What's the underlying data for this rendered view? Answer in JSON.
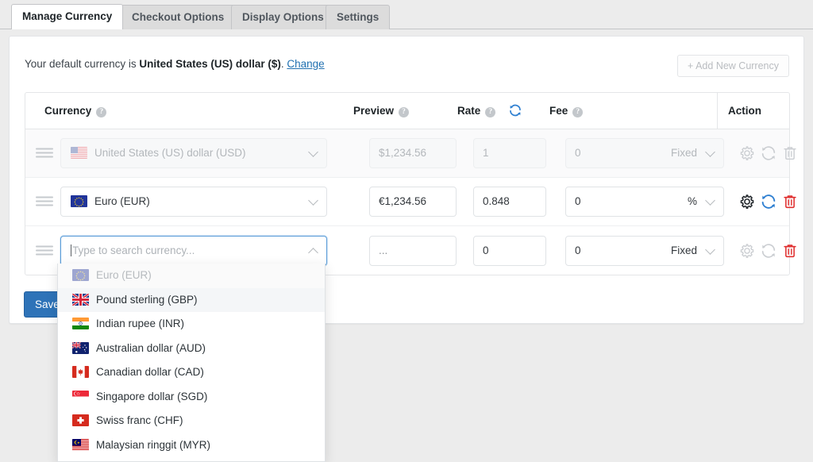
{
  "tabs": [
    {
      "label": "Manage Currency",
      "active": true
    },
    {
      "label": "Checkout Options",
      "active": false
    },
    {
      "label": "Display Options",
      "active": false
    },
    {
      "label": "Settings",
      "active": false
    }
  ],
  "panel": {
    "default_prefix": "Your default currency is ",
    "default_currency": "United States (US) dollar ($)",
    "default_suffix": ".",
    "change_link": "Change",
    "add_new_currency": "+ Add New Currency",
    "save_button": "Save Changes"
  },
  "table": {
    "headers": {
      "currency": "Currency",
      "preview": "Preview",
      "rate": "Rate",
      "fee": "Fee",
      "action": "Action",
      "help_glyph": "?"
    },
    "rows": [
      {
        "currency": "United States (US) dollar (USD)",
        "flag": "flag-us",
        "preview": "$1,234.56",
        "rate": "1",
        "fee": "0",
        "fee_unit": "Fixed",
        "state": "disabled"
      },
      {
        "currency": "Euro (EUR)",
        "flag": "flag-eu",
        "preview": "€1,234.56",
        "rate": "0.848",
        "fee": "0",
        "fee_unit": "%",
        "state": "active"
      },
      {
        "currency": "",
        "currency_placeholder": "Type to search currency...",
        "flag": "none",
        "preview": "...",
        "rate": "0",
        "fee": "0",
        "fee_unit": "Fixed",
        "state": "editing"
      }
    ],
    "action_icons": [
      "gear-icon",
      "refresh-icon",
      "trash-icon"
    ]
  },
  "dropdown": {
    "options": [
      {
        "label": "Euro (EUR)",
        "flag": "flag-eu",
        "state": "disabled"
      },
      {
        "label": "Pound sterling (GBP)",
        "flag": "flag-gb",
        "state": "highlighted"
      },
      {
        "label": "Indian rupee (INR)",
        "flag": "flag-in",
        "state": "normal"
      },
      {
        "label": "Australian dollar (AUD)",
        "flag": "flag-au",
        "state": "normal"
      },
      {
        "label": "Canadian dollar (CAD)",
        "flag": "flag-ca",
        "state": "normal"
      },
      {
        "label": "Singapore dollar (SGD)",
        "flag": "flag-sg",
        "state": "normal"
      },
      {
        "label": "Swiss franc (CHF)",
        "flag": "flag-ch",
        "state": "normal"
      },
      {
        "label": "Malaysian ringgit (MYR)",
        "flag": "flag-my",
        "state": "normal"
      }
    ]
  },
  "colors": {
    "accent_blue": "#2271b1",
    "save_blue": "#2e73b8",
    "danger_red": "#e03030",
    "refresh_blue": "#2e7fd1",
    "page_bg": "#ececec"
  }
}
